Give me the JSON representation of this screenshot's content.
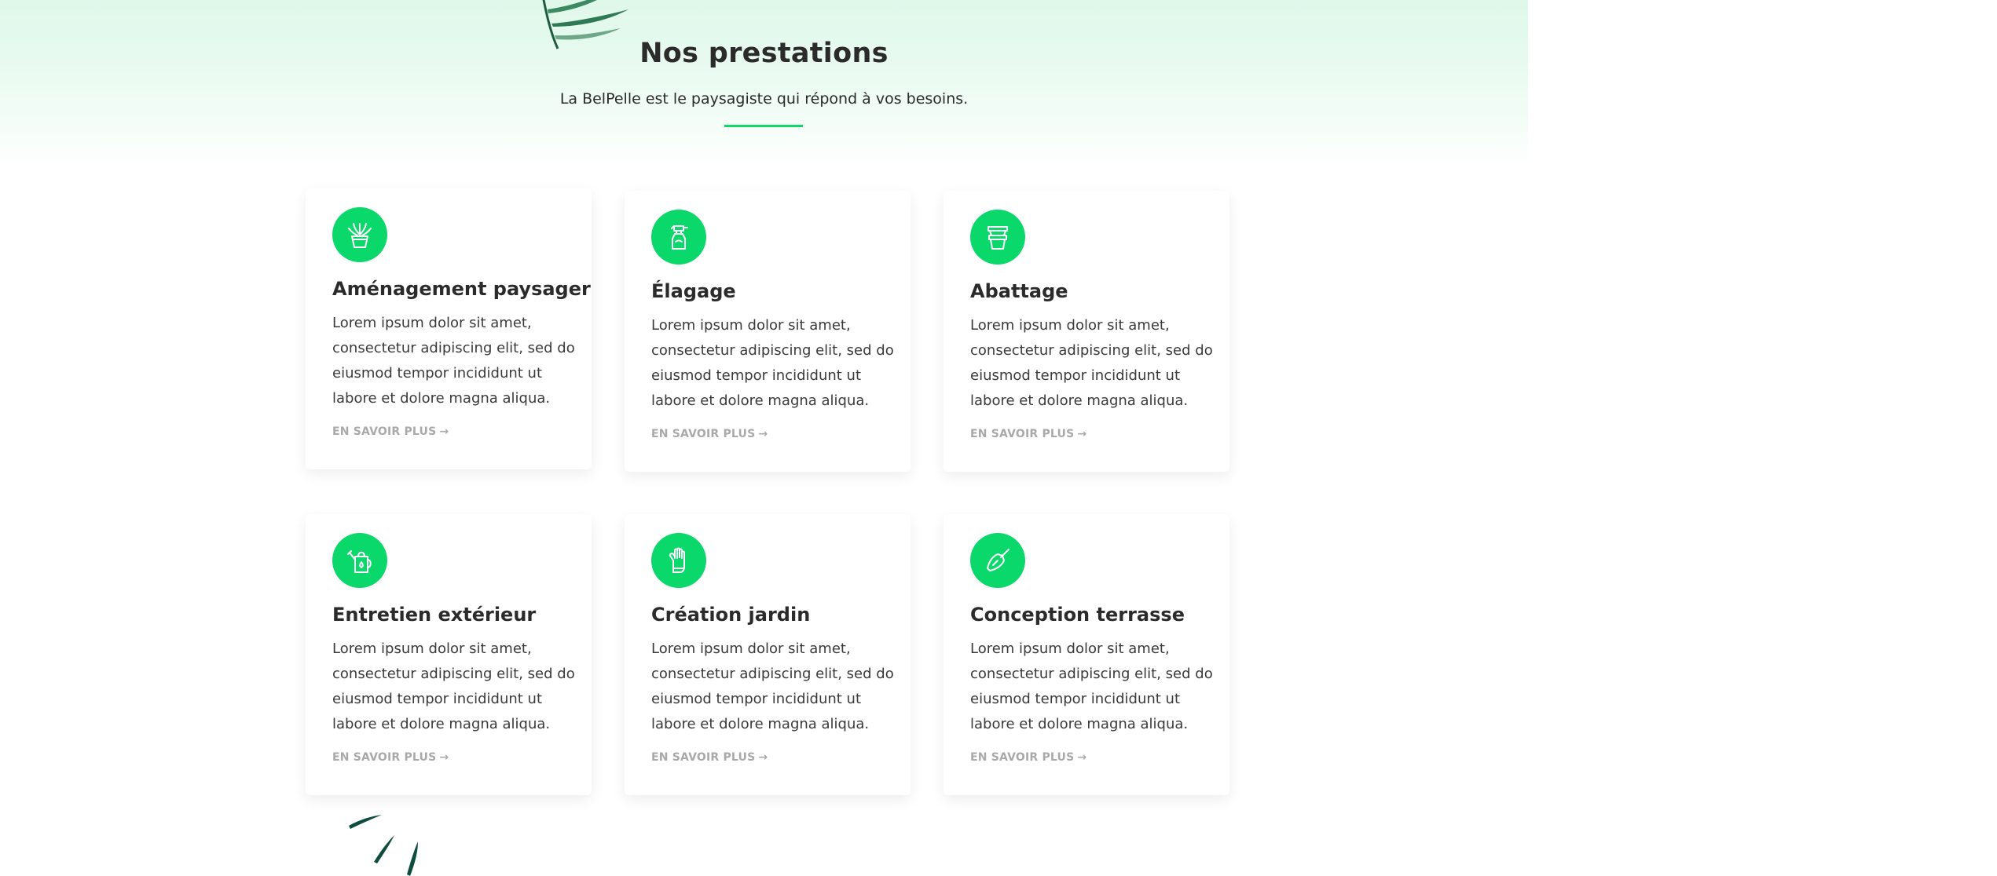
{
  "section": {
    "title": "Nos prestations",
    "subtitle": "La BelPelle est le paysagiste qui répond à vos besoins."
  },
  "colors": {
    "accent": "#0bd86a",
    "heading": "#2b2b2b",
    "link": "#a9a9a9",
    "hero_gradient_top": "#dff8ea"
  },
  "cards": [
    {
      "icon": "plant-pot-icon",
      "title": "Aménagement paysager",
      "text": "Lorem ipsum dolor sit amet, consectetur adipiscing elit, sed do eiusmod tempor incididunt ut labore et dolore magna aliqua.",
      "link": "EN SAVOIR PLUS",
      "arrow": "→"
    },
    {
      "icon": "spray-bottle-icon",
      "title": "Élagage",
      "text": "Lorem ipsum dolor sit amet, consectetur adipiscing elit, sed do eiusmod tempor incididunt ut labore et dolore magna aliqua.",
      "link": "EN SAVOIR PLUS",
      "arrow": "→"
    },
    {
      "icon": "stacked-pots-icon",
      "title": "Abattage",
      "text": "Lorem ipsum dolor sit amet, consectetur adipiscing elit, sed do eiusmod tempor incididunt ut labore et dolore magna aliqua.",
      "link": "EN SAVOIR PLUS",
      "arrow": "→"
    },
    {
      "icon": "watering-can-icon",
      "title": "Entretien extérieur",
      "text": "Lorem ipsum dolor sit amet, consectetur adipiscing elit, sed do eiusmod tempor incididunt ut labore et dolore magna aliqua.",
      "link": "EN SAVOIR PLUS",
      "arrow": "→"
    },
    {
      "icon": "garden-glove-icon",
      "title": "Création jardin",
      "text": "Lorem ipsum dolor sit amet, consectetur adipiscing elit, sed do eiusmod tempor incididunt ut labore et dolore magna aliqua.",
      "link": "EN SAVOIR PLUS",
      "arrow": "→"
    },
    {
      "icon": "trowel-icon",
      "title": "Conception terrasse",
      "text": "Lorem ipsum dolor sit amet, consectetur adipiscing elit, sed do eiusmod tempor incididunt ut labore et dolore magna aliqua.",
      "link": "EN SAVOIR PLUS",
      "arrow": "→"
    }
  ]
}
